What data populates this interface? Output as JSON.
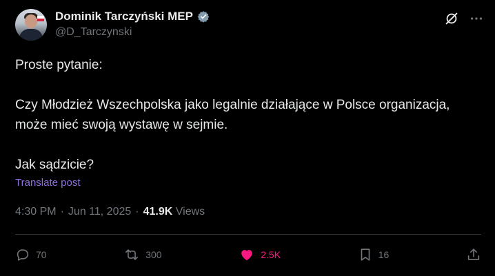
{
  "author": {
    "name": "Dominik Tarczyński MEP",
    "handle": "@D_Tarczynski"
  },
  "post": {
    "paragraphs": [
      "Proste pytanie:",
      "Czy Młodzież Wszechpolska jako legalnie działające w Polsce organizacja, może mieć swoją wystawę w sejmie.",
      "Jak sądzicie?"
    ],
    "translate_label": "Translate post",
    "time": "4:30 PM",
    "sep1": "·",
    "date": "Jun 11, 2025",
    "sep2": "·",
    "views_count": "41.9K",
    "views_label": "Views"
  },
  "actions": {
    "replies": "70",
    "reposts": "300",
    "likes": "2.5K",
    "bookmarks": "16"
  },
  "colors": {
    "background": "#000000",
    "text": "#e7e9ea",
    "muted": "#71767b",
    "like": "#f91880",
    "verified": "#829aab",
    "translate": "#8e6fe0"
  },
  "icons": [
    "grok-icon",
    "more-icon",
    "verified-badge-icon",
    "reply-icon",
    "repost-icon",
    "like-icon",
    "bookmark-icon",
    "share-icon"
  ]
}
